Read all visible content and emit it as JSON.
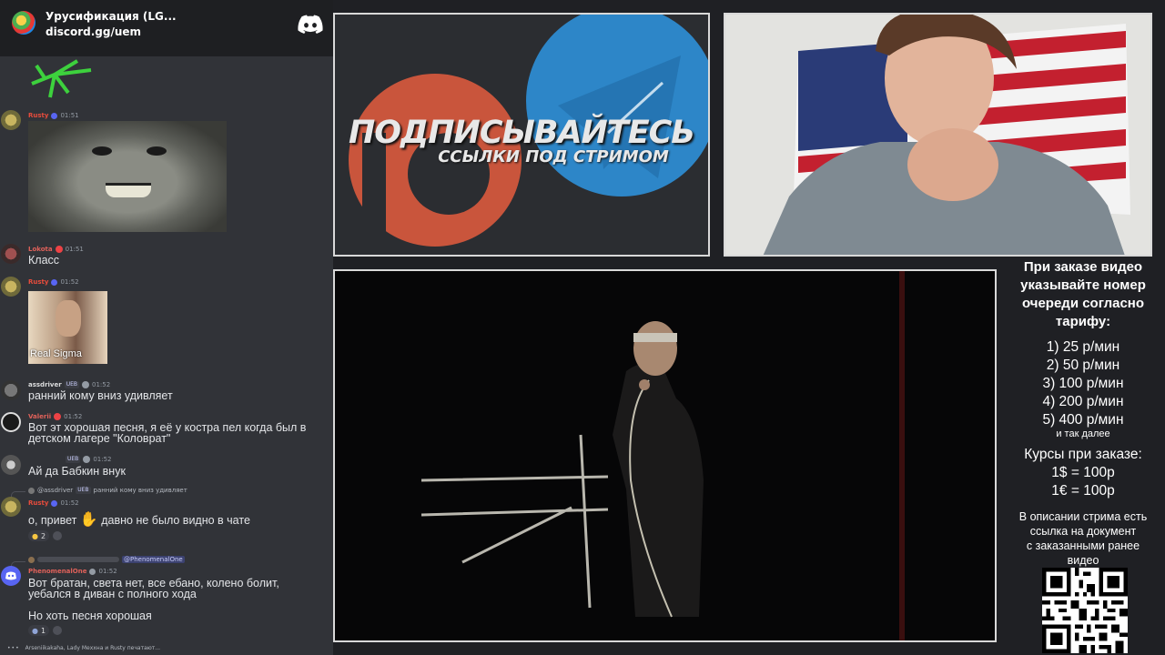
{
  "discord": {
    "server_name": "Урусификация (LG...",
    "invite": "discord.gg/uem",
    "typing": "Arseniikakaha, Lady Мехxна и Rusty печатают...",
    "messages": [
      {
        "user": "Rusty",
        "time": "01:51"
      },
      {
        "user": "Lokota",
        "time": "01:51",
        "text": "Класс"
      },
      {
        "user": "Rusty",
        "time": "01:52",
        "image_caption": "Real Sigma"
      },
      {
        "user": "assdriver",
        "badge": "UEB",
        "time": "01:52",
        "text": "ранний кому вниз удивляет"
      },
      {
        "user": "Valerii",
        "time": "01:52",
        "text1": "Вот эт хорошая песня, я её у костра пел когда был в",
        "text2": "детском лагере \"Коловрат\""
      },
      {
        "user": "",
        "badge": "UEB",
        "time": "01:52",
        "text": "Ай да Бабкин внук"
      },
      {
        "user": "Rusty",
        "time": "01:52",
        "reply_user": "@assdriver",
        "reply_badge": "UEB",
        "reply_text": "ранний кому вниз удивляет",
        "text_a": "о, привет",
        "text_b": "давно не было видно в чате",
        "reaction_count": "2"
      },
      {
        "user": "PhenomenalOne",
        "time": "01:52",
        "reply_mention": "@PhenomenalOne",
        "text1": "Вот братан, света нет, все ебано, колено болит,",
        "text2": "уебался в диван с полного хода",
        "text3": "Но хоть песня хорошая",
        "reaction_count": "1"
      }
    ]
  },
  "promo": {
    "title": "ПОДПИСЫВАЙТЕСЬ",
    "subtitle": "ССЫЛКИ ПОД СТРИМОМ"
  },
  "info": {
    "intro1": "При заказе видео",
    "intro2": "указывайте номер",
    "intro3": "очереди согласно",
    "intro4": "тарифу:",
    "tariffs": [
      "1) 25 р/мин",
      "2) 50 р/мин",
      "3) 100 р/мин",
      "4) 200 р/мин",
      "5) 400 р/мин"
    ],
    "etc": "и так далее",
    "rates_title": "Курсы при заказе:",
    "rate_usd": "1$ = 100р",
    "rate_eur": "1€ = 100р",
    "desc1": "В описании стрима есть",
    "desc2": "ссылка на документ",
    "desc3": "с заказанными ранее",
    "desc4": "видео"
  },
  "colors": {
    "rusty": "#e74c3c",
    "lokota": "#e0615a",
    "valerii": "#e0615a",
    "phenomenal": "#e0615a",
    "discord_blurple": "#5865f2"
  }
}
